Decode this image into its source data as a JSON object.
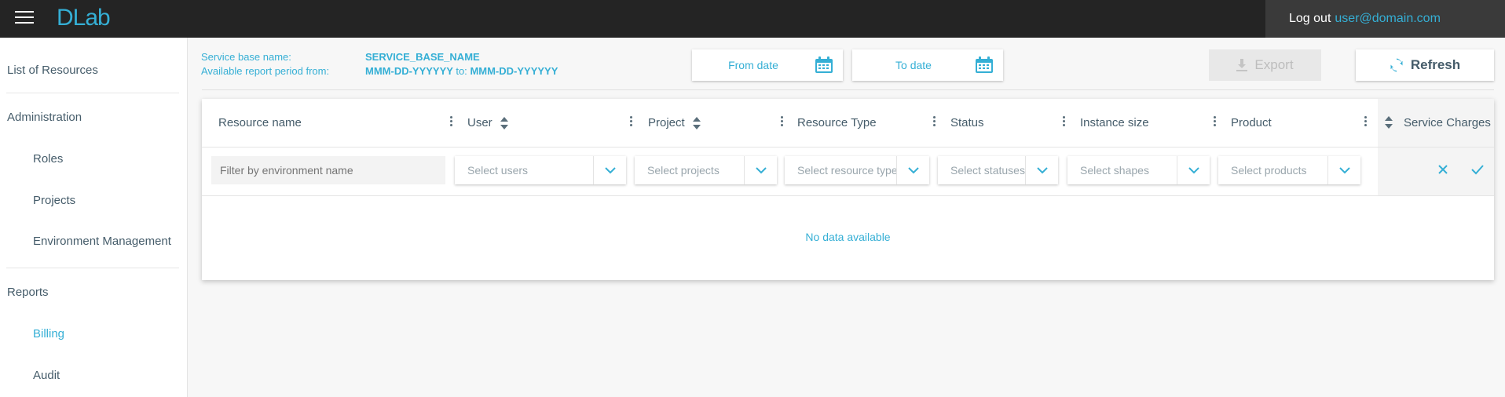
{
  "app": {
    "logo": "DLab"
  },
  "topbar": {
    "logout_label": "Log out",
    "user_email": "user@domain.com"
  },
  "sidebar": {
    "items": [
      {
        "label": "List of Resources"
      },
      {
        "label": "Administration"
      },
      {
        "label": "Roles"
      },
      {
        "label": "Projects"
      },
      {
        "label": "Environment Management"
      },
      {
        "label": "Reports"
      },
      {
        "label": "Billing"
      },
      {
        "label": "Audit"
      }
    ]
  },
  "report": {
    "service_label": "Service base name:",
    "service_value": "SERVICE_BASE_NAME",
    "period_label": "Available report period from:",
    "period_from": "MMM-DD-YYYYYY",
    "period_to_label": "to:",
    "period_to": "MMM-DD-YYYYYY"
  },
  "toolbar": {
    "from_date": "From date",
    "to_date": "To date",
    "export": "Export",
    "refresh": "Refresh"
  },
  "table": {
    "columns": [
      "Resource name",
      "User",
      "Project",
      "Resource Type",
      "Status",
      "Instance size",
      "Product",
      "Service Charges"
    ],
    "filters": {
      "resource_name_placeholder": "Filter by environment name",
      "users": "Select users",
      "projects": "Select projects",
      "resource_types": "Select resource types",
      "statuses": "Select statuses",
      "shapes": "Select shapes",
      "products": "Select products"
    },
    "empty_message": "No data available"
  },
  "colors": {
    "accent": "#35afd5",
    "topbar": "#242424",
    "text": "#455c6a"
  }
}
